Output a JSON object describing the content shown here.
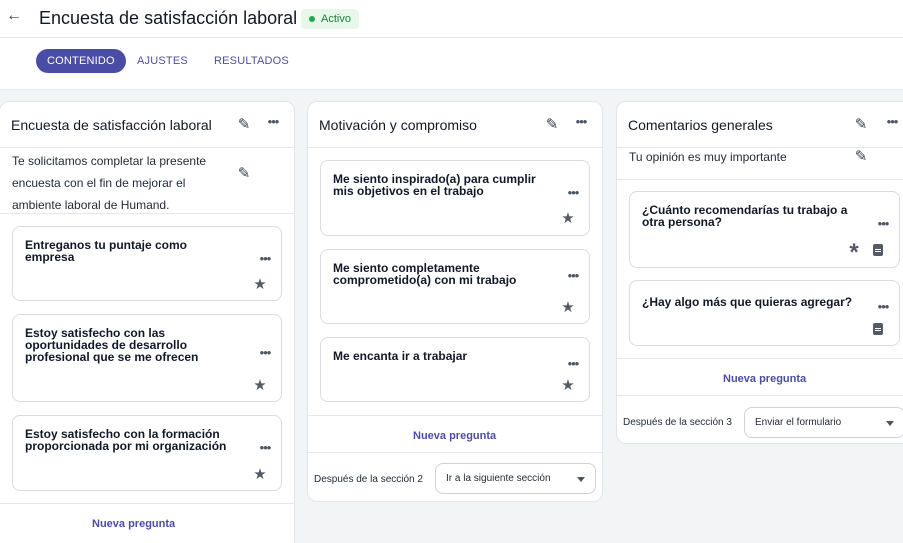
{
  "header": {
    "back_icon": "arrow-left-icon",
    "title": "Encuesta de satisfacción laboral",
    "status": "Activo",
    "status_color": "#22a84a"
  },
  "tabs": [
    {
      "label": "CONTENIDO",
      "active": true
    },
    {
      "label": "AJUSTES",
      "active": false
    },
    {
      "label": "RESULTADOS",
      "active": false
    }
  ],
  "colors": {
    "accent": "#4a4da6",
    "background": "#f3f4f6"
  },
  "sections": [
    {
      "title": "Encuesta de satisfacción laboral",
      "description": [
        "Te solicitamos completar la presente",
        "encuesta con el fin de mejorar el",
        "ambiente laboral de Humand."
      ],
      "questions": [
        {
          "text": [
            "Entreganos tu puntaje como",
            "empresa"
          ]
        },
        {
          "text": [
            "Estoy satisfecho con las",
            "oportunidades de desarrollo",
            "profesional que se me ofrecen"
          ]
        },
        {
          "text": [
            "Estoy satisfecho con la formación",
            "proporcionada por mi organización"
          ]
        }
      ],
      "new_question": "Nueva pregunta"
    },
    {
      "title": "Motivación y compromiso",
      "questions": [
        {
          "text": [
            "Me siento inspirado(a) para cumplir",
            "mis objetivos en el trabajo"
          ]
        },
        {
          "text": [
            "Me siento completamente",
            "comprometido(a) con mi trabajo"
          ]
        },
        {
          "text": [
            "Me encanta ir a trabajar"
          ]
        }
      ],
      "new_question": "Nueva pregunta",
      "after_label": "Después de la sección 2",
      "after_value": "Ir a la siguiente sección"
    },
    {
      "title": "Comentarios generales",
      "description": [
        "Tu opinión es muy importante"
      ],
      "questions": [
        {
          "text": [
            "¿Cuánto recomendarías tu trabajo a",
            "otra persona?"
          ]
        },
        {
          "text": [
            "¿Hay algo más que quieras agregar?"
          ]
        }
      ],
      "new_question": "Nueva pregunta",
      "after_label": "Después de la sección 3",
      "after_value": "Enviar el formulario"
    }
  ]
}
